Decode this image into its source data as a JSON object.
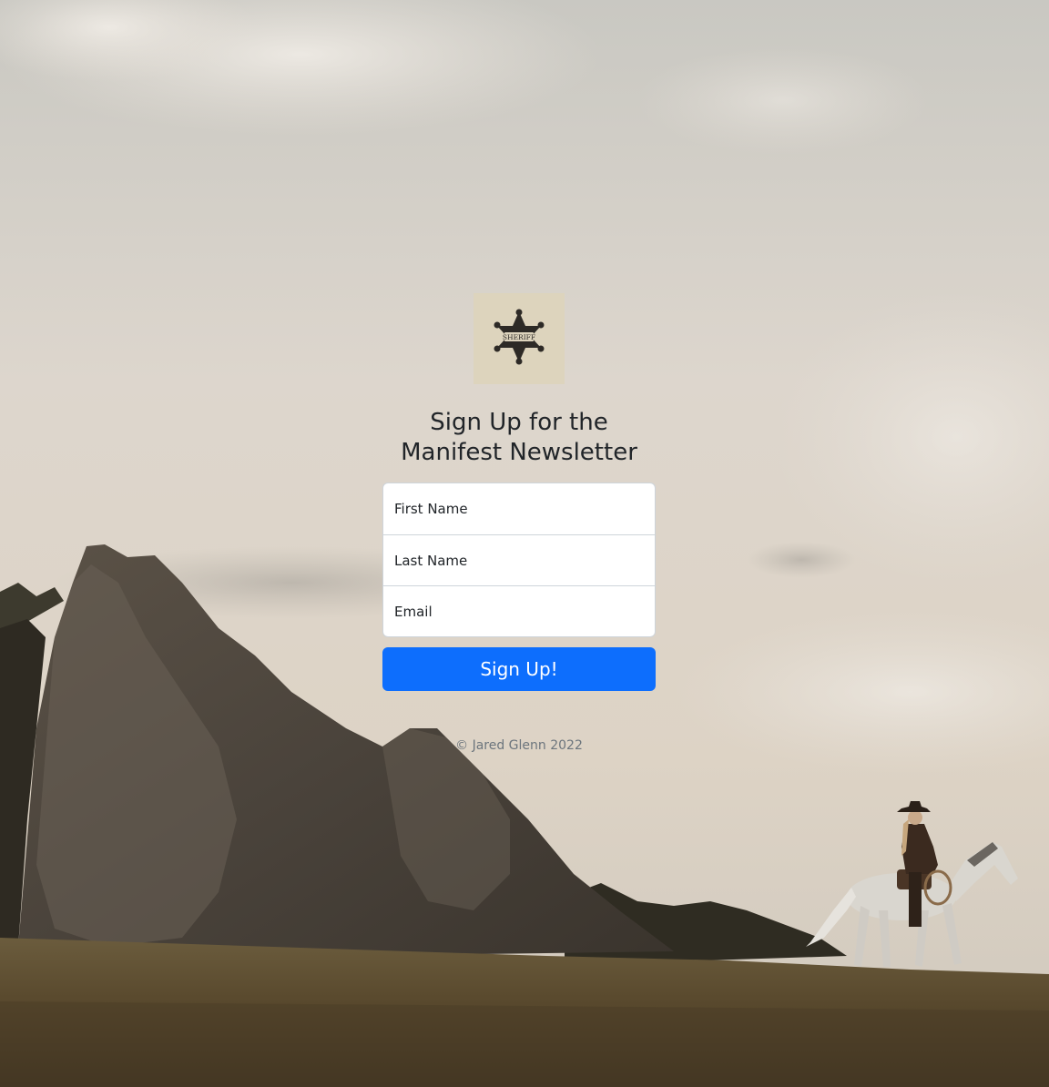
{
  "form": {
    "heading_line1": "Sign Up for the",
    "heading_line2": "Manifest Newsletter",
    "fields": [
      {
        "placeholder": "First Name"
      },
      {
        "placeholder": "Last Name"
      },
      {
        "placeholder": "Email"
      }
    ],
    "submit_label": "Sign Up!"
  },
  "logo": {
    "icon": "sheriff-badge-icon",
    "badge_text": "SHERIFF"
  },
  "footer": {
    "copyright": "© Jared Glenn 2022"
  },
  "colors": {
    "primary": "#0d6efd",
    "logo_bg": "#ddd4bd",
    "muted_text": "#6c757d",
    "heading_text": "#212529"
  },
  "background": {
    "icon": "western-landscape-photo"
  }
}
